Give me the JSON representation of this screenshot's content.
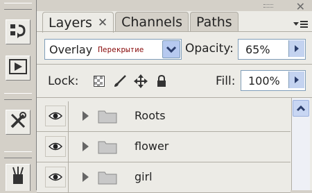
{
  "tabs": [
    {
      "label": "Layers",
      "close": "✕"
    },
    {
      "label": "Channels"
    },
    {
      "label": "Paths"
    }
  ],
  "window": {
    "close": "✕"
  },
  "blend_mode": {
    "value": "Overlay",
    "localized": "Перекрытие"
  },
  "opacity": {
    "label": "Opacity:",
    "value": "65%"
  },
  "lock": {
    "label": "Lock:"
  },
  "fill": {
    "label": "Fill:",
    "value": "100%"
  },
  "layers": [
    {
      "name": "Roots"
    },
    {
      "name": "flower"
    },
    {
      "name": "girl"
    }
  ],
  "colors": {
    "field_border": "#7f9db9",
    "dropdown_btn": "#b6c9ef",
    "panel_bg": "#ecebe6",
    "chrome_bg": "#d4d0c8"
  }
}
